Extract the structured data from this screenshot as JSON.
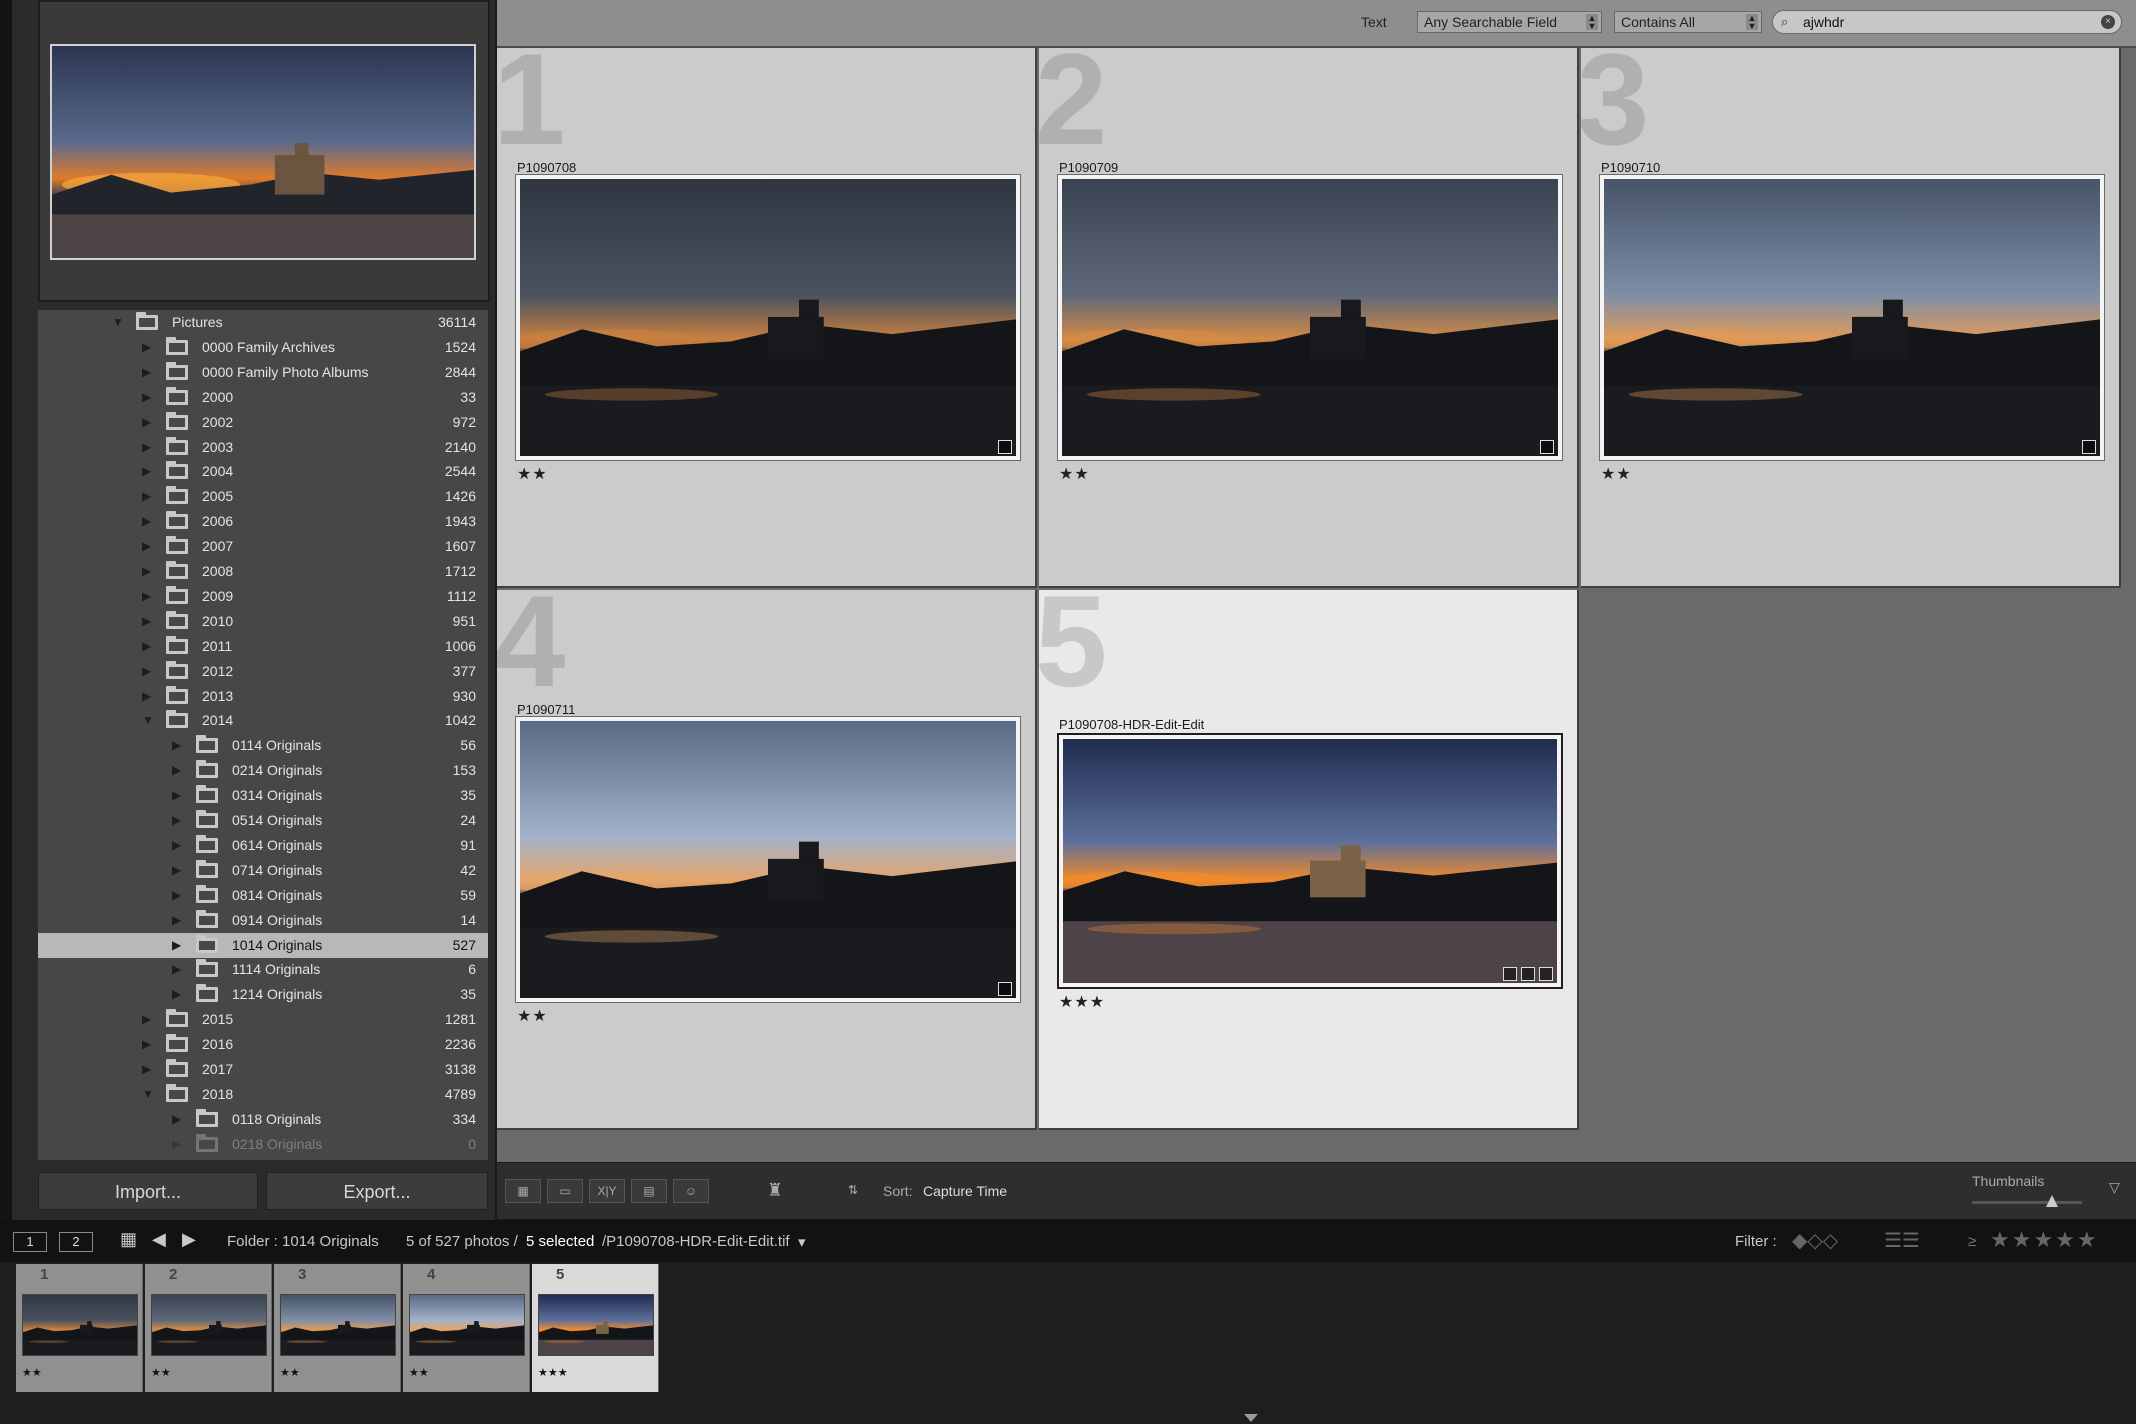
{
  "folders": {
    "pictures": {
      "name": "Pictures",
      "count": "36114"
    },
    "items": [
      {
        "name": "0000 Family Archives",
        "count": "1524"
      },
      {
        "name": "0000 Family Photo Albums",
        "count": "2844"
      },
      {
        "name": "2000",
        "count": "33"
      },
      {
        "name": "2002",
        "count": "972"
      },
      {
        "name": "2003",
        "count": "2140"
      },
      {
        "name": "2004",
        "count": "2544"
      },
      {
        "name": "2005",
        "count": "1426"
      },
      {
        "name": "2006",
        "count": "1943"
      },
      {
        "name": "2007",
        "count": "1607"
      },
      {
        "name": "2008",
        "count": "1712"
      },
      {
        "name": "2009",
        "count": "1112"
      },
      {
        "name": "2010",
        "count": "951"
      },
      {
        "name": "2011",
        "count": "1006"
      },
      {
        "name": "2012",
        "count": "377"
      },
      {
        "name": "2013",
        "count": "930"
      },
      {
        "name": "2014",
        "count": "1042"
      },
      {
        "name": "0114 Originals",
        "count": "56"
      },
      {
        "name": "0214 Originals",
        "count": "153"
      },
      {
        "name": "0314 Originals",
        "count": "35"
      },
      {
        "name": "0514 Originals",
        "count": "24"
      },
      {
        "name": "0614 Originals",
        "count": "91"
      },
      {
        "name": "0714 Originals",
        "count": "42"
      },
      {
        "name": "0814 Originals",
        "count": "59"
      },
      {
        "name": "0914 Originals",
        "count": "14"
      },
      {
        "name": "1014 Originals",
        "count": "527"
      },
      {
        "name": "1114 Originals",
        "count": "6"
      },
      {
        "name": "1214 Originals",
        "count": "35"
      },
      {
        "name": "2015",
        "count": "1281"
      },
      {
        "name": "2016",
        "count": "2236"
      },
      {
        "name": "2017",
        "count": "3138"
      },
      {
        "name": "2018",
        "count": "4789"
      },
      {
        "name": "0118 Originals",
        "count": "334"
      },
      {
        "name": "0218 Originals",
        "count": "0"
      }
    ]
  },
  "buttons": {
    "import": "Import...",
    "export": "Export..."
  },
  "filter_bar": {
    "label": "Text",
    "field_select": "Any Searchable Field",
    "rule_select": "Contains All",
    "search_value": "ajwhdr"
  },
  "grid": [
    {
      "index": "1",
      "name": "P1090708",
      "stars": "★★"
    },
    {
      "index": "2",
      "name": "P1090709",
      "stars": "★★"
    },
    {
      "index": "3",
      "name": "P1090710",
      "stars": "★★"
    },
    {
      "index": "4",
      "name": "P1090711",
      "stars": "★★"
    },
    {
      "index": "5",
      "name": "P1090708-HDR-Edit-Edit",
      "stars": "★★★"
    }
  ],
  "toolbar": {
    "sort_label": "Sort:",
    "sort_value": "Capture Time",
    "thumbnails_label": "Thumbnails",
    "compare_label": "X|Y",
    "thumbnail_size": 0.73
  },
  "status_bar": {
    "monitor1": "1",
    "monitor2": "2",
    "folder": "Folder : 1014 Originals",
    "count": "5 of 527 photos /",
    "selected": "5 selected",
    "filename": "/P1090708-HDR-Edit-Edit.tif",
    "filter_label": "Filter :",
    "filter_op": "≥",
    "filter_stars": "★★★★★"
  },
  "colors": {
    "selected_cell": "#e9e9e9",
    "cell": "#cbcbcb",
    "panel": "#474747"
  }
}
